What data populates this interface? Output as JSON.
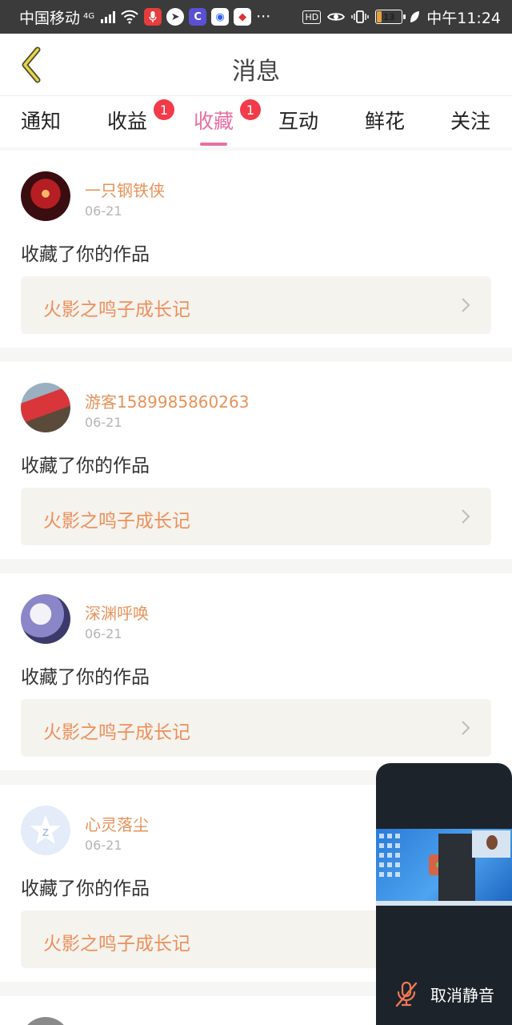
{
  "status_bar": {
    "carrier": "中国移动",
    "network": "4G",
    "more": "···",
    "hd": "HD",
    "battery": "13",
    "time": "中午11:24"
  },
  "header": {
    "title": "消息"
  },
  "tabs": [
    {
      "label": "通知",
      "badge": ""
    },
    {
      "label": "收益",
      "badge": "1"
    },
    {
      "label": "收藏",
      "badge": "1",
      "active": true
    },
    {
      "label": "互动",
      "badge": ""
    },
    {
      "label": "鲜花",
      "badge": ""
    },
    {
      "label": "关注",
      "badge": ""
    }
  ],
  "items": [
    {
      "name": "一只钢铁侠",
      "date": "06-21",
      "action": "收藏了你的作品",
      "work": "火影之鸣子成长记"
    },
    {
      "name": "游客1589985860263",
      "date": "06-21",
      "action": "收藏了你的作品",
      "work": "火影之鸣子成长记"
    },
    {
      "name": "深渊呼唤",
      "date": "06-21",
      "action": "收藏了你的作品",
      "work": "火影之鸣子成长记"
    },
    {
      "name": "心灵落尘",
      "date": "06-21",
      "action": "收藏了你的作品",
      "work": "火影之鸣子成长记"
    }
  ],
  "float_widget": {
    "unmute_label": "取消静音"
  },
  "colors": {
    "accent": "#e86fa3",
    "username": "#e8925a",
    "work_title": "#ee8f5c",
    "badge": "#f23a4a"
  }
}
